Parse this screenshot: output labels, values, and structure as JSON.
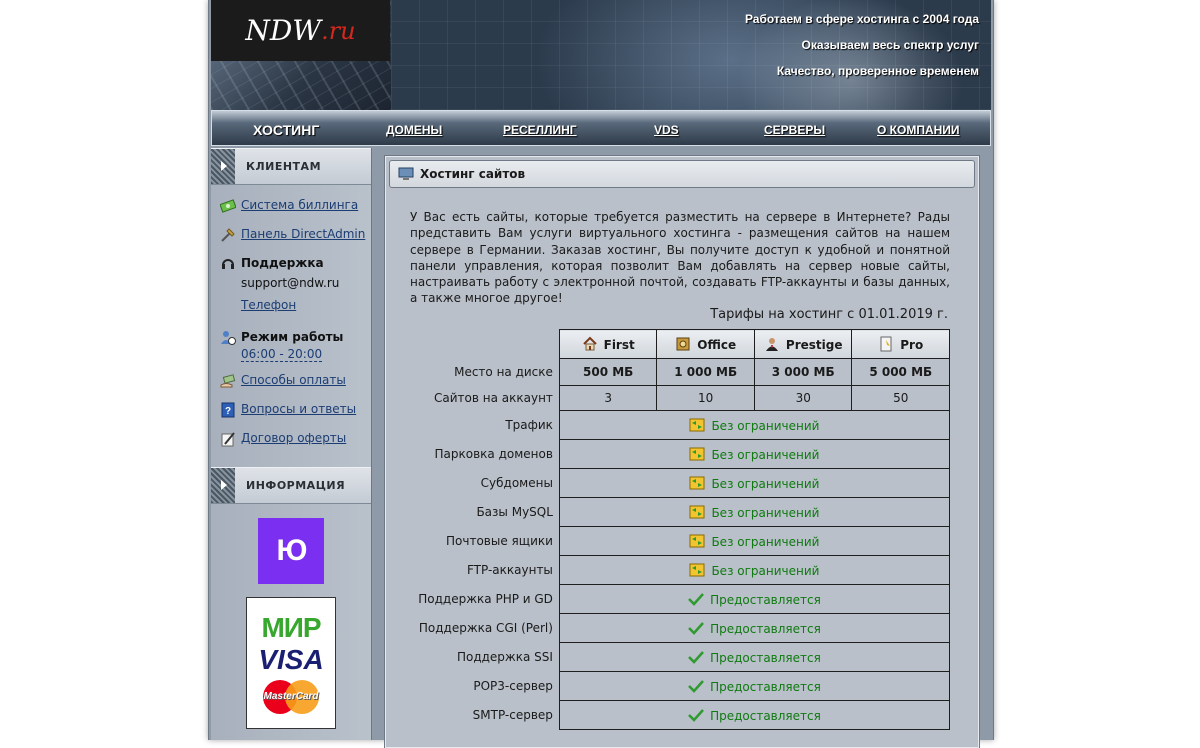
{
  "header": {
    "logo_main": "NDW",
    "logo_suffix": ".ru",
    "slogans": [
      "Работаем в сфере хостинга с 2004 года",
      "Оказываем весь спектр услуг",
      "Качество, проверенное временем"
    ]
  },
  "nav": {
    "items": [
      {
        "label": "ХОСТИНГ",
        "active": true
      },
      {
        "label": "ДОМЕНЫ"
      },
      {
        "label": "РЕСЕЛЛИНГ"
      },
      {
        "label": "VDS"
      },
      {
        "label": "СЕРВЕРЫ"
      },
      {
        "label": "О КОМПАНИИ"
      }
    ]
  },
  "sidebar": {
    "clients_title": "КЛИЕНТАМ",
    "billing": "Система биллинга",
    "directadmin": "Панель DirectAdmin",
    "support_title": "Поддержка",
    "support_email": "support@ndw.ru",
    "phone": "Телефон",
    "hours_title": "Режим работы",
    "hours": "06:00 - 20:00",
    "payment": "Способы оплаты",
    "faq": "Вопросы и ответы",
    "offer": "Договор оферты",
    "info_title": "ИНФОРМАЦИЯ",
    "yoomoney_logo": "Ю",
    "cards": {
      "mir": "МИР",
      "visa": "VISA",
      "mastercard": "MasterCard"
    }
  },
  "content": {
    "title": "Хостинг сайтов",
    "intro": "У Вас есть сайты, которые требуется разместить на сервере в Интернете? Рады представить Вам услуги виртуального хостинга - размещения сайтов на нашем сервере в Германии. Заказав хостинг, Вы получите доступ к удобной и понятной панели управления, которая позволит Вам добавлять на сервер новые сайты, настраивать работу с электронной почтой, создавать FTP-аккаунты и базы данных, а также многое другое!",
    "tariffs_title": "Тарифы на хостинг с 01.01.2019 г."
  },
  "tariffs": {
    "plans": [
      "First",
      "Office",
      "Prestige",
      "Pro"
    ],
    "disk_label": "Место на диске",
    "disk": [
      "500 МБ",
      "1 000 МБ",
      "3 000 МБ",
      "5 000 МБ"
    ],
    "sites_label": "Сайтов на аккаунт",
    "sites": [
      "3",
      "10",
      "30",
      "50"
    ],
    "unlimited_text": "Без ограничений",
    "provided_text": "Предоставляется",
    "unlimited_rows": [
      "Трафик",
      "Парковка доменов",
      "Субдомены",
      "Базы MySQL",
      "Почтовые ящики",
      "FTP-аккаунты"
    ],
    "provided_rows": [
      "Поддержка PHP и GD",
      "Поддержка CGI (Perl)",
      "Поддержка SSI",
      "POP3-сервер",
      "SMTP-сервер"
    ]
  }
}
